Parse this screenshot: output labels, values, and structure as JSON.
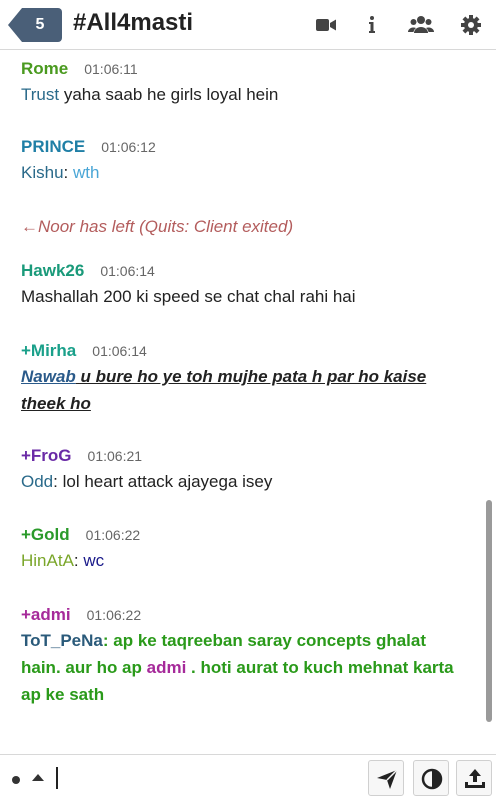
{
  "header": {
    "unread_count": "5",
    "channel": "#All4masti",
    "icons": [
      "video-camera-icon",
      "info-icon",
      "users-icon",
      "gear-icon"
    ]
  },
  "messages": [
    {
      "nick": "Rome",
      "nick_color": "#4a9a1f",
      "time": "01:06:11",
      "text": [
        {
          "t": "Trust",
          "c": "#2a6a8a"
        },
        {
          "t": " yaha saab he girls loyal hein",
          "c": "#222222"
        }
      ]
    },
    {
      "nick": "PRINCE",
      "nick_color": "#1f7fa6",
      "time": "01:06:12",
      "text": [
        {
          "t": "Kishu",
          "c": "#2a6a8a"
        },
        {
          "t": ": ",
          "c": "#222222"
        },
        {
          "t": "wth",
          "c": "#4aa6d6"
        }
      ]
    },
    {
      "nick": "Hawk26",
      "nick_color": "#1a9a7a",
      "time": "01:06:14",
      "text": [
        {
          "t": "Mashallah 200 ki speed se chat chal rahi hai",
          "c": "#222222"
        }
      ]
    },
    {
      "nick": "+Mirha",
      "nick_color": "#1aa08a",
      "time": "01:06:14",
      "text": [
        {
          "t": "Nawab",
          "c": "#2a5a8a",
          "b": true,
          "i": true,
          "u": true
        },
        {
          "t": " u bure ho ye toh mujhe pata h par ho kaise theek ho",
          "c": "#222222",
          "b": true,
          "i": true,
          "u": true
        }
      ]
    },
    {
      "nick": "+FroG",
      "nick_color": "#6a2aa6",
      "time": "01:06:21",
      "text": [
        {
          "t": "Odd",
          "c": "#2a6a8a"
        },
        {
          "t": ": lol heart attack ajayega isey",
          "c": "#222222"
        }
      ]
    },
    {
      "nick": "+Gold",
      "nick_color": "#2a9a2a",
      "time": "01:06:22",
      "text": [
        {
          "t": "HinAtA",
          "c": "#7aa62a"
        },
        {
          "t": ": ",
          "c": "#222222"
        },
        {
          "t": "wc",
          "c": "#1a1a8a"
        }
      ]
    },
    {
      "nick": "+admi",
      "nick_color": "#a62a9a",
      "time": "01:06:22",
      "text": [
        {
          "t": "ToT_PeNa",
          "c": "#2a5a7a",
          "b": true
        },
        {
          "t": ": ap ke taqreeban saray concepts ghalat hain. aur ho ap ",
          "c": "#2a9a1a",
          "b": true
        },
        {
          "t": "admi",
          "c": "#a62a9a",
          "b": true
        },
        {
          "t": " . hoti aurat to kuch mehnat karta ap ke sath",
          "c": "#2a9a1a",
          "b": true
        }
      ]
    }
  ],
  "part_notice": "←Noor has left (Quits: Client exited)",
  "composer": {
    "buttons": [
      "send-icon",
      "contrast-icon",
      "upload-icon"
    ]
  },
  "colors": {
    "badge_bg": "#4a5f78",
    "part_text": "#b35c5c"
  }
}
